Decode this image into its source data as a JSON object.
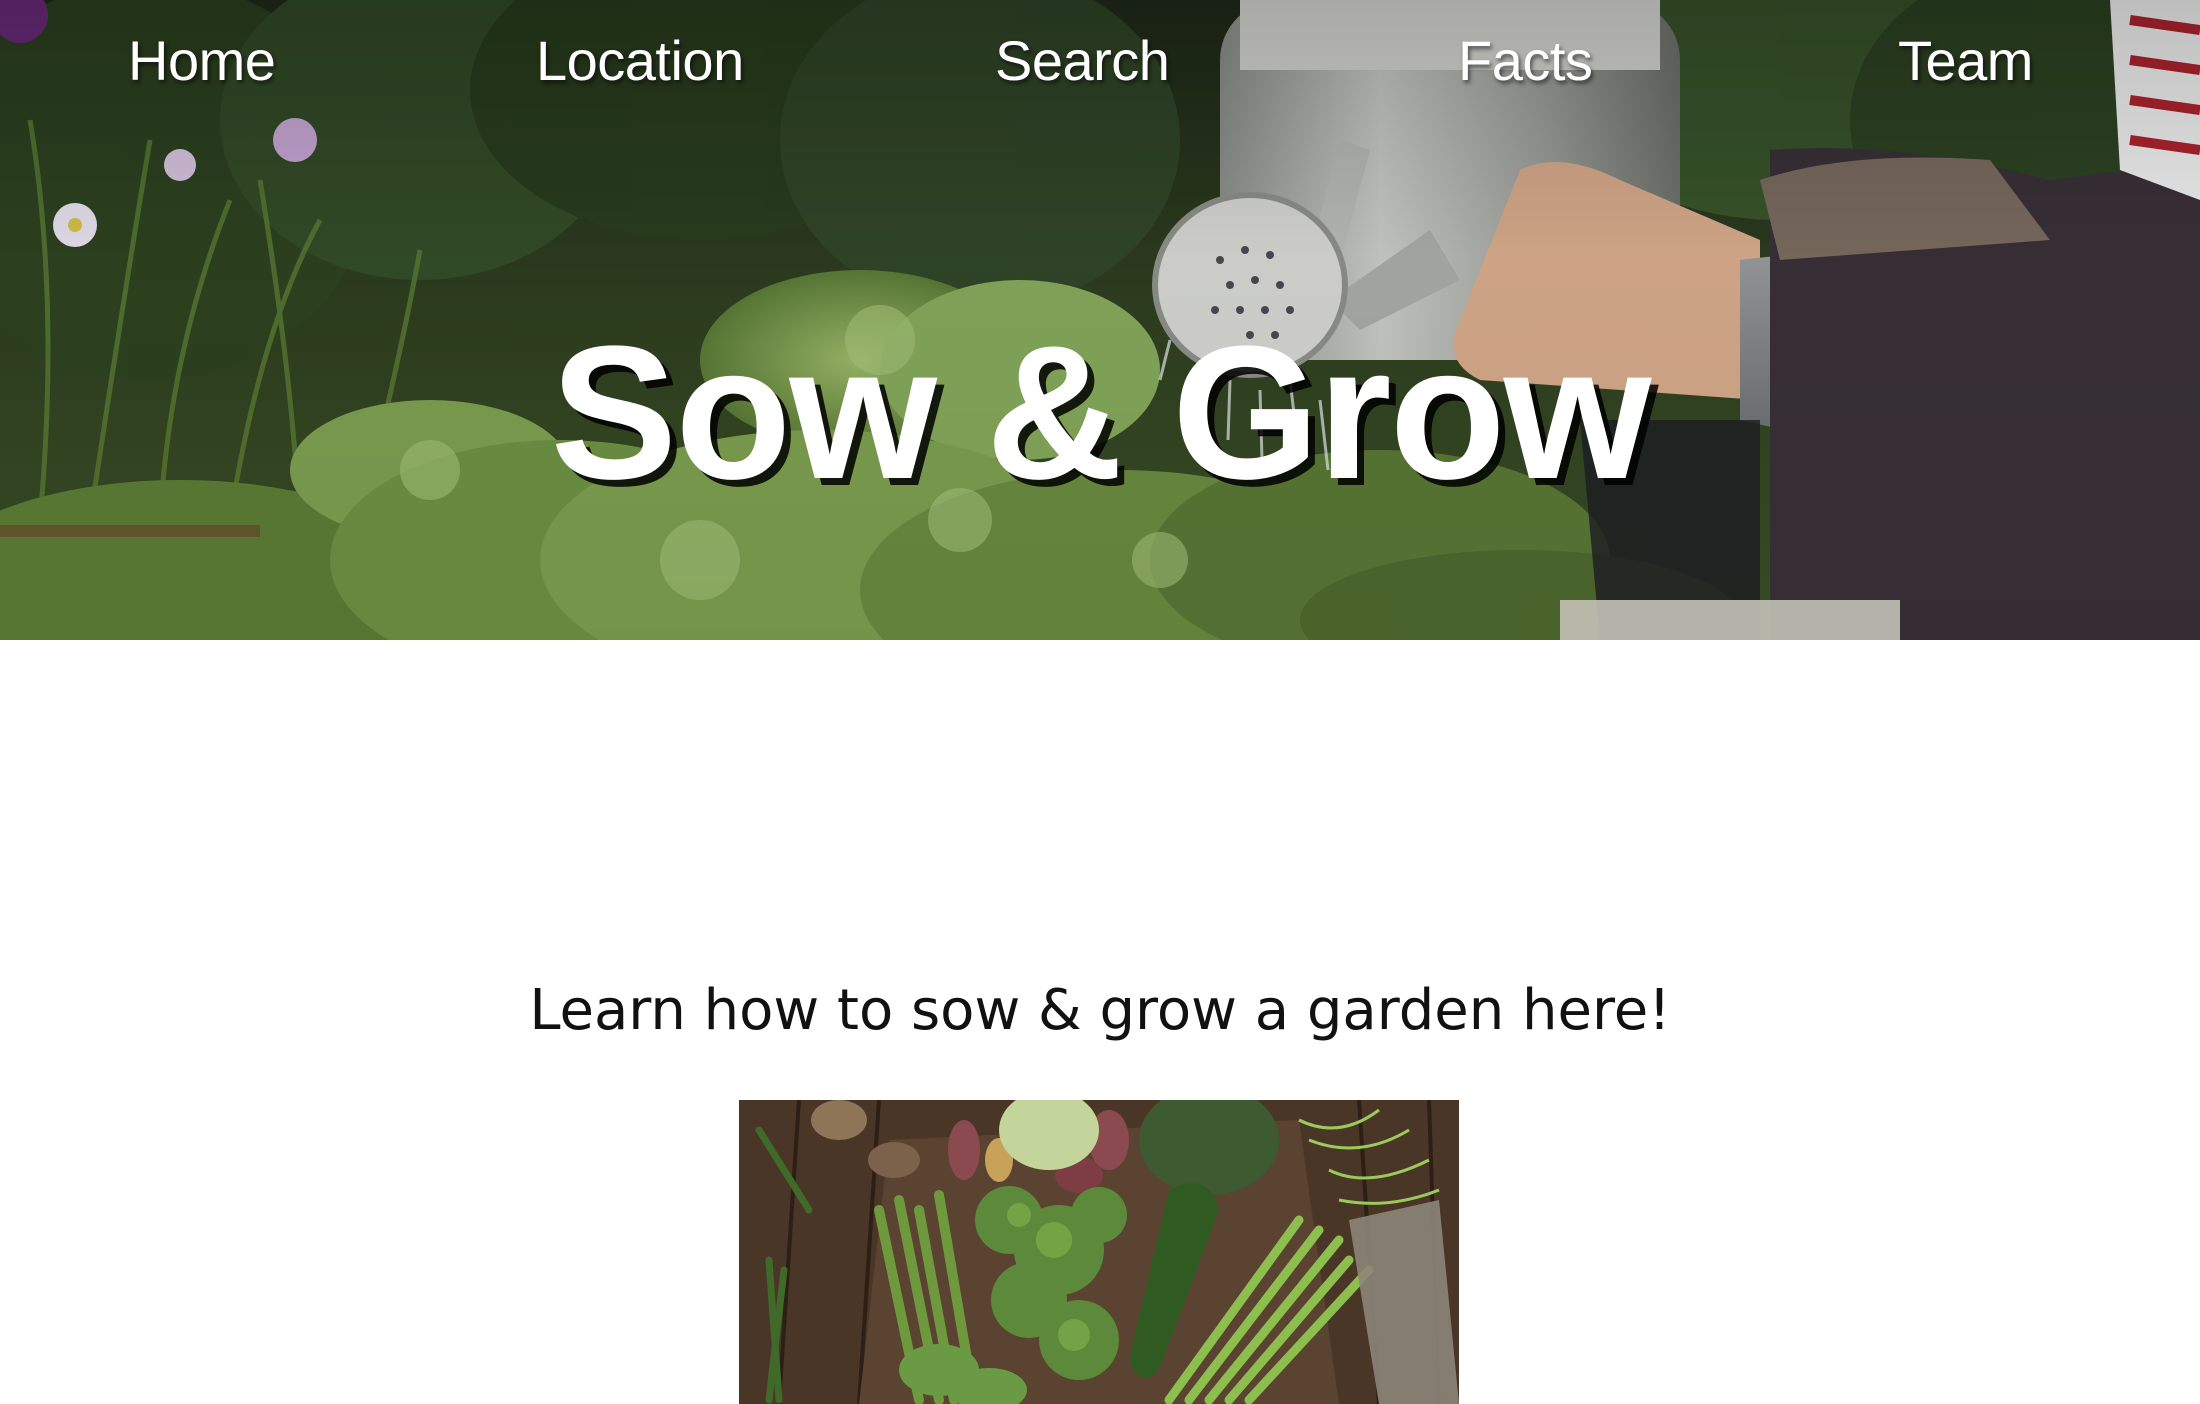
{
  "nav": {
    "items": [
      {
        "label": "Home"
      },
      {
        "label": "Location"
      },
      {
        "label": "Search"
      },
      {
        "label": "Facts"
      },
      {
        "label": "Team"
      }
    ]
  },
  "hero": {
    "title": "Sow & Grow"
  },
  "main": {
    "tagline": "Learn how to sow & grow a garden here!"
  },
  "colors": {
    "nav_text": "#ffffff",
    "title_text": "#ffffff",
    "title_shadow": "#000000",
    "tagline_text": "#111111",
    "page_background": "#ffffff"
  }
}
